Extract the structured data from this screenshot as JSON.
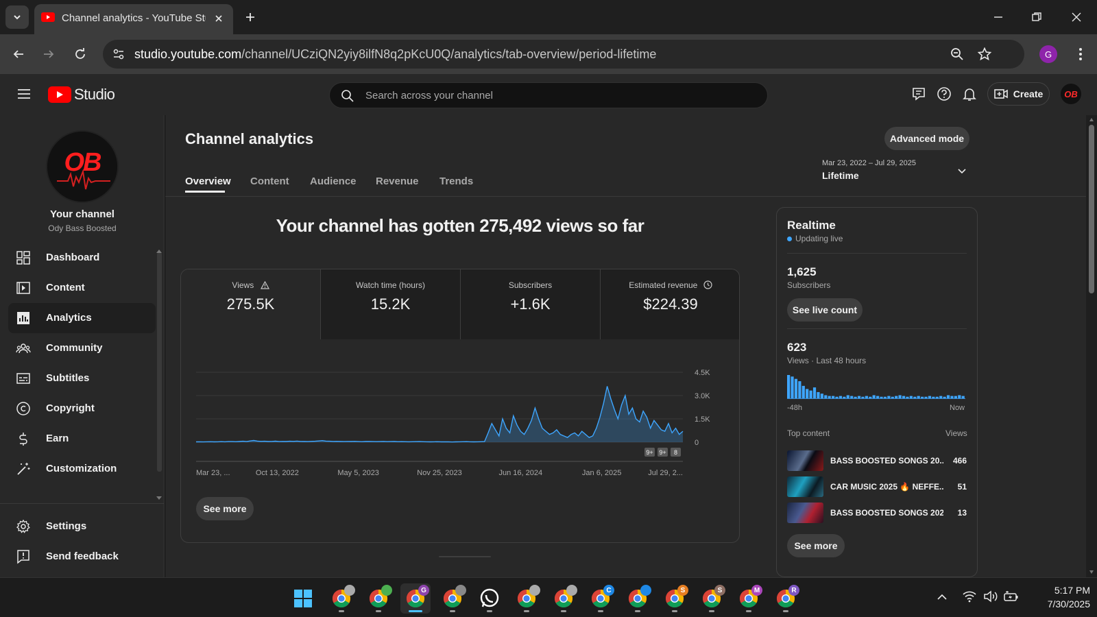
{
  "browser": {
    "tab_title": "Channel analytics - YouTube Studio",
    "url_host": "studio.youtube.com",
    "url_path": "/channel/UCziQN2yiy8ilfN8q2pKcU0Q/analytics/tab-overview/period-lifetime",
    "profile_initial": "G"
  },
  "studio": {
    "logo_text": "Studio",
    "search_placeholder": "Search across your channel",
    "create_label": "Create",
    "channel_avatar_text": "OB"
  },
  "sidebar": {
    "channel_label": "Your channel",
    "channel_name": "Ody Bass Boosted",
    "items": [
      {
        "label": "Dashboard",
        "icon": "dashboard-icon"
      },
      {
        "label": "Content",
        "icon": "content-icon"
      },
      {
        "label": "Analytics",
        "icon": "analytics-icon",
        "active": true
      },
      {
        "label": "Community",
        "icon": "community-icon"
      },
      {
        "label": "Subtitles",
        "icon": "subtitles-icon"
      },
      {
        "label": "Copyright",
        "icon": "copyright-icon"
      },
      {
        "label": "Earn",
        "icon": "earn-icon"
      },
      {
        "label": "Customization",
        "icon": "customization-icon"
      }
    ],
    "settings_label": "Settings",
    "feedback_label": "Send feedback"
  },
  "analytics": {
    "title": "Channel analytics",
    "advanced_mode_label": "Advanced mode",
    "tabs": [
      "Overview",
      "Content",
      "Audience",
      "Revenue",
      "Trends"
    ],
    "active_tab": "Overview",
    "date_range": "Mar 23, 2022 – Jul 29, 2025",
    "period_label": "Lifetime",
    "headline": "Your channel has gotten 275,492 views so far",
    "metrics": [
      {
        "label": "Views",
        "value": "275.5K"
      },
      {
        "label": "Watch time (hours)",
        "value": "15.2K"
      },
      {
        "label": "Subscribers",
        "value": "+1.6K"
      },
      {
        "label": "Estimated revenue",
        "value": "$224.39"
      }
    ],
    "see_more_label": "See more",
    "chart_markers": [
      "9+",
      "9+",
      "8"
    ]
  },
  "chart_data": {
    "type": "line",
    "series": [
      {
        "values": [
          20,
          22,
          18,
          25,
          30,
          22,
          28,
          35,
          25,
          40,
          38,
          30,
          45,
          60,
          40,
          80,
          110,
          70,
          55,
          60,
          45,
          50,
          65,
          40,
          50,
          45,
          60,
          55,
          70,
          50,
          45,
          40,
          55,
          60,
          80,
          100,
          70,
          60,
          50,
          55,
          45,
          40,
          50,
          45,
          55,
          40,
          30,
          45,
          50,
          40,
          35,
          40,
          50,
          35,
          40,
          45,
          30,
          35,
          30,
          25,
          30,
          35,
          40,
          30,
          25,
          20,
          25,
          30,
          20,
          25,
          20,
          15,
          20,
          25,
          30,
          35,
          25,
          20,
          25,
          30,
          40,
          600,
          1200,
          800,
          400,
          1500,
          900,
          600,
          1700,
          1100,
          700,
          500,
          900,
          1400,
          2200,
          1500,
          900,
          700,
          500,
          600,
          800,
          500,
          400,
          300,
          500,
          600,
          400,
          700,
          500,
          300,
          400,
          900,
          1600,
          2500,
          3600,
          2800,
          2100,
          1500,
          2400,
          3000,
          1800,
          2200,
          1500,
          1300,
          2000,
          1600,
          900,
          1400,
          1100,
          800,
          700,
          1200,
          600,
          900,
          500,
          700
        ]
      }
    ],
    "x_ticks": [
      "Mar 23, ...",
      "Oct 13, 2022",
      "May 5, 2023",
      "Nov 25, 2023",
      "Jun 16, 2024",
      "Jan 6, 2025",
      "Jul 29, 2..."
    ],
    "y_ticks": [
      "4.5K",
      "3.0K",
      "1.5K",
      "0"
    ],
    "ylim": [
      0,
      4500
    ],
    "color": "#3ea6ff",
    "grid": true
  },
  "realtime": {
    "title": "Realtime",
    "status": "Updating live",
    "subscribers_value": "1,625",
    "subscribers_label": "Subscribers",
    "live_count_label": "See live count",
    "views_value": "623",
    "views_label": "Views · Last 48 hours",
    "bars": [
      30,
      28,
      25,
      22,
      16,
      12,
      10,
      14,
      8,
      6,
      4,
      3,
      3,
      2,
      3,
      2,
      4,
      3,
      2,
      3,
      2,
      3,
      2,
      4,
      3,
      2,
      2,
      3,
      2,
      3,
      4,
      3,
      2,
      3,
      2,
      3,
      2,
      2,
      3,
      2,
      2,
      3,
      2,
      4,
      3,
      3,
      4,
      3
    ],
    "axis_start": "-48h",
    "axis_end": "Now",
    "top_content_label": "Top content",
    "views_col_label": "Views",
    "top_content": [
      {
        "title": "BASS BOOSTED SONGS 20...",
        "views": "466"
      },
      {
        "title": "CAR MUSIC 2025 🔥 NEFFE...",
        "views": "51"
      },
      {
        "title": "BASS BOOSTED SONGS 202...",
        "views": "13"
      }
    ],
    "see_more_label": "See more"
  },
  "taskbar": {
    "time": "5:17 PM",
    "date": "7/30/2025",
    "badges": [
      "",
      "",
      "G",
      "",
      "",
      "",
      "",
      "C",
      "",
      "S",
      "S",
      "M",
      "R"
    ],
    "badge_colors": [
      "#aaaaaa",
      "#4caf50",
      "#8e44ad",
      "#888888",
      "#25d366",
      "#aaaaaa",
      "#aaaaaa",
      "#1e88e5",
      "#1e88e5",
      "#e67e22",
      "#8d6e63",
      "#ab47bc",
      "#7e57c2"
    ]
  }
}
